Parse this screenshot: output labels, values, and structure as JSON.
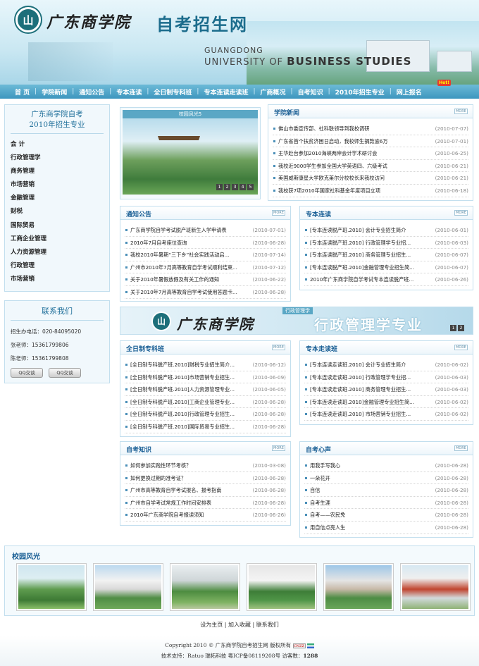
{
  "banner": {
    "logo_glyph": "山",
    "school_cn": "广东商学院",
    "site_title": "自考招生网",
    "english_line1": "GUANGDONG",
    "english_line2_prefix": "UNIVERSITY OF ",
    "english_line2_bold": "BUSINESS STUDIES"
  },
  "nav": {
    "items": [
      "首 页",
      "学院新闻",
      "通知公告",
      "专本连读",
      "全日制专科班",
      "专本连读走读班",
      "广商概况",
      "自考知识",
      "2010年招生专业",
      "网上报名"
    ],
    "hot_badge": "Hot!"
  },
  "left": {
    "majors_title_line1": "广东商学院自考",
    "majors_title_line2": "2010年招生专业",
    "majors": [
      "会 计",
      "行政管理学",
      "商务管理",
      "市场营销",
      "金融管理",
      "财税",
      "国际贸易",
      "工商企业管理",
      "人力资源管理",
      "行政管理",
      "市场营销"
    ],
    "contact_title": "联系我们",
    "contact_lines": [
      "招生办电话：020-84095020",
      "张老师：15361799806",
      "陈老师：15361799808"
    ],
    "qq_label": "QQ交谈"
  },
  "slideshow": {
    "caption": "校园风光5",
    "pages": [
      "1",
      "2",
      "3",
      "4",
      "5"
    ]
  },
  "news": {
    "title": "学院新闻",
    "more": "MORE",
    "items": [
      {
        "t": "佛山市委宣传部、社科联领导到我校调研",
        "d": "(2010-07-07)"
      },
      {
        "t": "广东省首个扶贫济困日启动，我校师生捐款逾6万",
        "d": "(2010-07-01)"
      },
      {
        "t": "王华赴台参加2010海峡两岸会计学术研讨会",
        "d": "(2010-06-25)"
      },
      {
        "t": "我校近9000学生参加全国大学英语四、六级考试",
        "d": "(2010-06-21)"
      },
      {
        "t": "美国威斯康星大学欧克莱尔分校校长来我校访问",
        "d": "(2010-06-21)"
      },
      {
        "t": "我校获7项2010年国家社科基金年度项目立项",
        "d": "(2010-06-18)"
      }
    ]
  },
  "notice": {
    "title": "通知公告",
    "more": "MORE",
    "items": [
      {
        "t": "广东商学院自学考试脱产班新生入学申请表",
        "d": "(2010-07-01)"
      },
      {
        "t": "2010年7月自考座位查询",
        "d": "(2010-06-28)"
      },
      {
        "t": "我校2010年暑期“三下乡”社会实践活动启...",
        "d": "(2010-07-14)"
      },
      {
        "t": "广州市2010年7月高等教育自学考试顺利结束...",
        "d": "(2010-07-12)"
      },
      {
        "t": "关于2010年暑假放假及有关工作的通知",
        "d": "(2010-06-22)"
      },
      {
        "t": "关于2010年7月高等教育自学考试使用答题卡...",
        "d": "(2010-06-28)"
      }
    ]
  },
  "zblk": {
    "title": "专本连读",
    "more": "MORE",
    "items": [
      {
        "t": "[专本连读脱产班.2010] 会计专业招生简介",
        "d": "(2010-06-01)"
      },
      {
        "t": "[专本连读脱产班.2010] 行政管理学专业招...",
        "d": "(2010-06-03)"
      },
      {
        "t": "[专本连读脱产班.2010] 商务管理专业招生...",
        "d": "(2010-06-07)"
      },
      {
        "t": "[专本连读脱产班.2010]金融管理专业招生简...",
        "d": "(2010-06-07)"
      },
      {
        "t": "2010年广东商学院自学考试专本连读脱产班...",
        "d": "(2010-06-26)"
      }
    ]
  },
  "ad": {
    "logo_glyph": "山",
    "school_cn": "广东商学院",
    "sub": "行政管理学",
    "big": "行政管理学专业",
    "pages": [
      "1",
      "2"
    ]
  },
  "qrz": {
    "title": "全日制专科班",
    "more": "MORE",
    "items": [
      {
        "t": "[全日制专科脱产班.2010]财税专业招生简介...",
        "d": "(2010-06-12)"
      },
      {
        "t": "[全日制专科脱产班.2010]市场营销专业招生...",
        "d": "(2010-06-09)"
      },
      {
        "t": "[全日制专科脱产班.2010]人力资源管理专业...",
        "d": "(2010-06-05)"
      },
      {
        "t": "[全日制专科脱产班.2010]工商企业管理专业...",
        "d": "(2010-06-28)"
      },
      {
        "t": "[全日制专科脱产班.2010]行政管理专业招生...",
        "d": "(2010-06-28)"
      },
      {
        "t": "[全日制专科脱产班.2010]国际贸易专业招生...",
        "d": "(2010-06-28)"
      }
    ]
  },
  "zbzd": {
    "title": "专本走读班",
    "more": "MORE",
    "items": [
      {
        "t": "[专本连读走读班.2010] 会计专业招生简介",
        "d": "(2010-06-02)"
      },
      {
        "t": "[专本连读走读班.2010] 行政管理学专业招...",
        "d": "(2010-06-03)"
      },
      {
        "t": "[专本连读走读班.2010] 商务管理专业招生...",
        "d": "(2010-06-03)"
      },
      {
        "t": "[专本连读走读班.2010]金融管理专业招生简...",
        "d": "(2010-06-02)"
      },
      {
        "t": "[专本连读走读班.2010] 市场营销专业招生...",
        "d": "(2010-06-02)"
      }
    ]
  },
  "zkzs": {
    "title": "自考知识",
    "more": "MORE",
    "items": [
      {
        "t": "如何参加实践性环节考核？",
        "d": "(2010-03-08)"
      },
      {
        "t": "如何更换过期的准考证？",
        "d": "(2010-06-28)"
      },
      {
        "t": "广州市高等教育自学考试报名、报考指南",
        "d": "(2010-06-28)"
      },
      {
        "t": "广州市自学考试常规工作时间安排表",
        "d": "(2010-06-28)"
      },
      {
        "t": "2010年广东商学院自考报读须知",
        "d": "(2010-06-26)"
      }
    ]
  },
  "zkxs": {
    "title": "自考心声",
    "more": "MORE",
    "items": [
      {
        "t": "用我手写我心",
        "d": "(2010-06-28)"
      },
      {
        "t": "一朵花开",
        "d": "(2010-06-28)"
      },
      {
        "t": "自信",
        "d": "(2010-06-28)"
      },
      {
        "t": "自考生涯",
        "d": "(2010-06-28)"
      },
      {
        "t": "自考——农民免",
        "d": "(2010-06-28)"
      },
      {
        "t": "用自信点亮人生",
        "d": "(2010-06-28)"
      }
    ]
  },
  "photos": {
    "title": "校园风光"
  },
  "footer": {
    "links": "设为主页 | 加入收藏 | 联系我们",
    "copyright": "Copyright 2010 © 广东商学院自考招生网 版权所有",
    "cnzz": "CNZZ",
    "support": "技术支持：Ratuo 瑞拓科技 粤ICP备08119208号 访客数：",
    "visits": "1288"
  }
}
